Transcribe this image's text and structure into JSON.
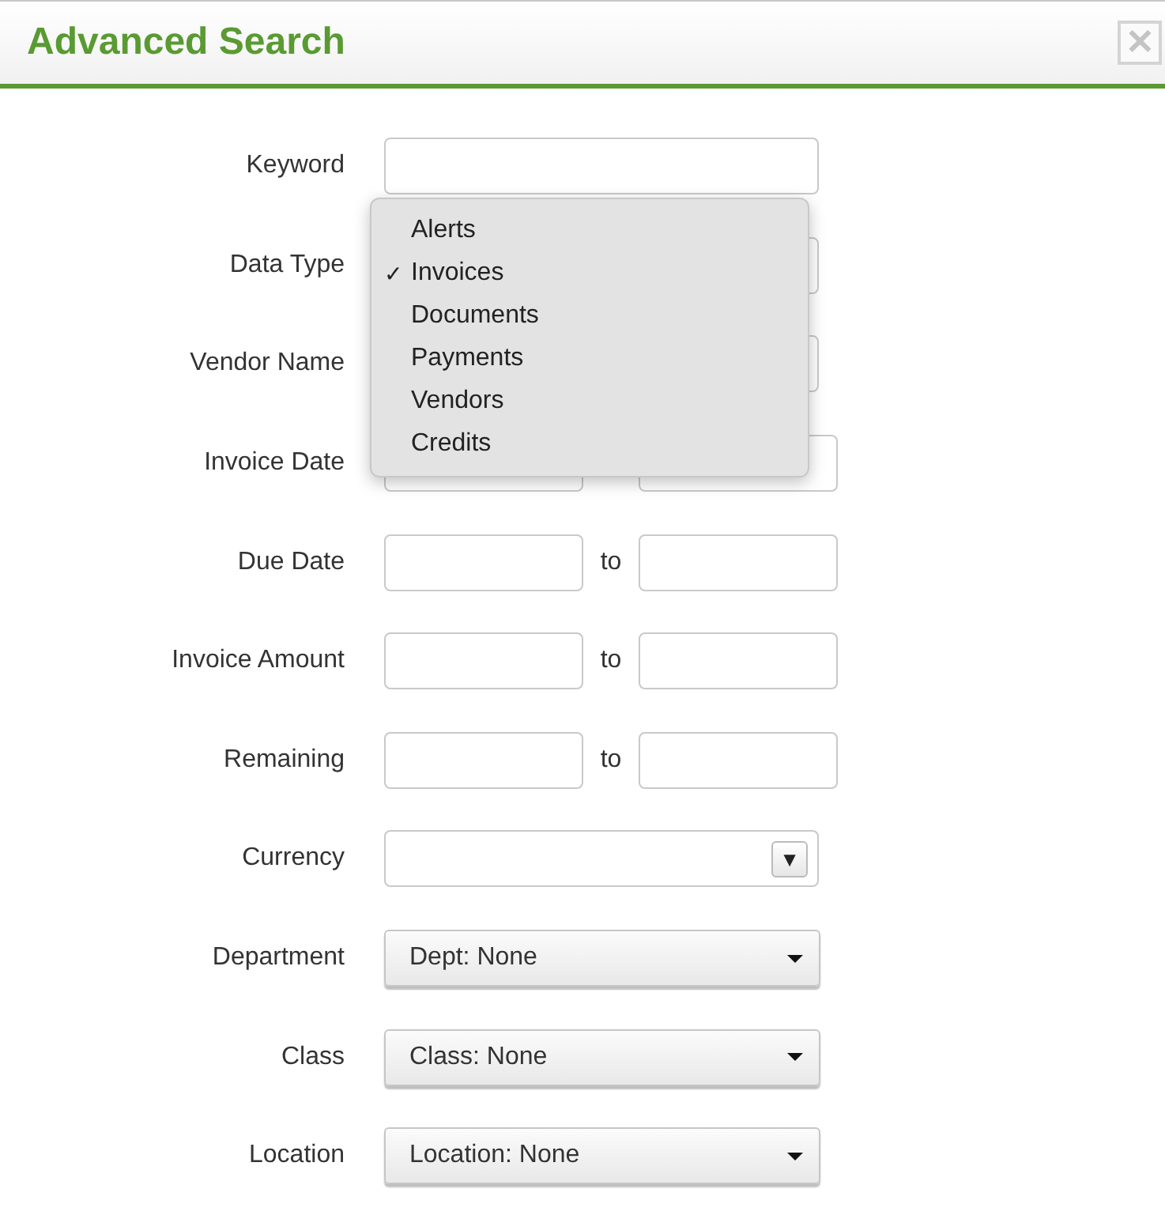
{
  "dialog": {
    "title": "Advanced Search",
    "close": "✕"
  },
  "fields": [
    {
      "kind": "text",
      "label": "Keyword"
    },
    {
      "kind": "select",
      "label": "Data Type"
    },
    {
      "kind": "select",
      "label": "Vendor Name"
    },
    {
      "kind": "range",
      "label": "Invoice Date"
    },
    {
      "kind": "range",
      "label": "Due Date",
      "separator": "to"
    },
    {
      "kind": "range",
      "label": "Invoice Amount",
      "separator": "to"
    },
    {
      "kind": "range",
      "label": "Remaining",
      "separator": "to"
    },
    {
      "kind": "combo",
      "label": "Currency",
      "toggle": "▼"
    },
    {
      "kind": "menu",
      "label": "Department",
      "value": "Dept: None"
    },
    {
      "kind": "menu",
      "label": "Class",
      "value": "Class: None"
    },
    {
      "kind": "menu",
      "label": "Location",
      "value": "Location: None"
    }
  ],
  "data_type_menu": {
    "check_mark": "✓",
    "items": [
      {
        "label": "Alerts",
        "selected": false
      },
      {
        "label": "Invoices",
        "selected": true
      },
      {
        "label": "Documents",
        "selected": false
      },
      {
        "label": "Payments",
        "selected": false
      },
      {
        "label": "Vendors",
        "selected": false
      },
      {
        "label": "Credits",
        "selected": false
      }
    ]
  }
}
